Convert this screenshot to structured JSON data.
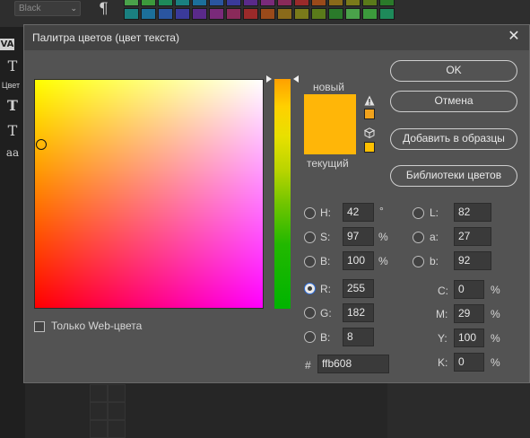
{
  "background": {
    "font_select": "Black",
    "pilcrow": "¶",
    "left_tools": [
      "VA",
      "T",
      "Цвет",
      "T",
      "T",
      "aa"
    ],
    "swatch_colors": [
      "#4aa24a",
      "#3c9a3c",
      "#1e8a5a",
      "#1a8080",
      "#1c6f9a",
      "#2a55a0",
      "#3a3a9a",
      "#5a2a8a",
      "#7a2a7a",
      "#8a2a5a",
      "#9a2a2a",
      "#9a4a1a",
      "#8a6a1a",
      "#7a7a1a",
      "#5a7a1a",
      "#2a7a2a"
    ]
  },
  "dialog": {
    "title": "Палитра цветов (цвет текста)",
    "close": "✕",
    "label_new": "новый",
    "label_current": "текущий",
    "new_color": "#ffb608",
    "current_color": "#ffb608",
    "gamut_swatch_color": "#f2a31c",
    "web_swatch_color": "#ffc000",
    "buttons": {
      "ok": "OK",
      "cancel": "Отмена",
      "add_to_swatches": "Добавить в образцы",
      "color_libraries": "Библиотеки цветов"
    },
    "web_only_label": "Только Web-цвета",
    "hsb": {
      "h": {
        "label": "H:",
        "value": "42",
        "unit": "°"
      },
      "s": {
        "label": "S:",
        "value": "97",
        "unit": "%"
      },
      "b": {
        "label": "B:",
        "value": "100",
        "unit": "%"
      }
    },
    "rgb": {
      "r": {
        "label": "R:",
        "value": "255"
      },
      "g": {
        "label": "G:",
        "value": "182"
      },
      "b": {
        "label": "B:",
        "value": "8"
      }
    },
    "lab": {
      "l": {
        "label": "L:",
        "value": "82"
      },
      "a": {
        "label": "a:",
        "value": "27"
      },
      "b": {
        "label": "b:",
        "value": "92"
      }
    },
    "cmyk": {
      "c": {
        "label": "C:",
        "value": "0",
        "unit": "%"
      },
      "m": {
        "label": "M:",
        "value": "29",
        "unit": "%"
      },
      "y": {
        "label": "Y:",
        "value": "100",
        "unit": "%"
      },
      "k": {
        "label": "K:",
        "value": "0",
        "unit": "%"
      }
    },
    "hex_label": "#",
    "hex_value": "ffb608"
  }
}
